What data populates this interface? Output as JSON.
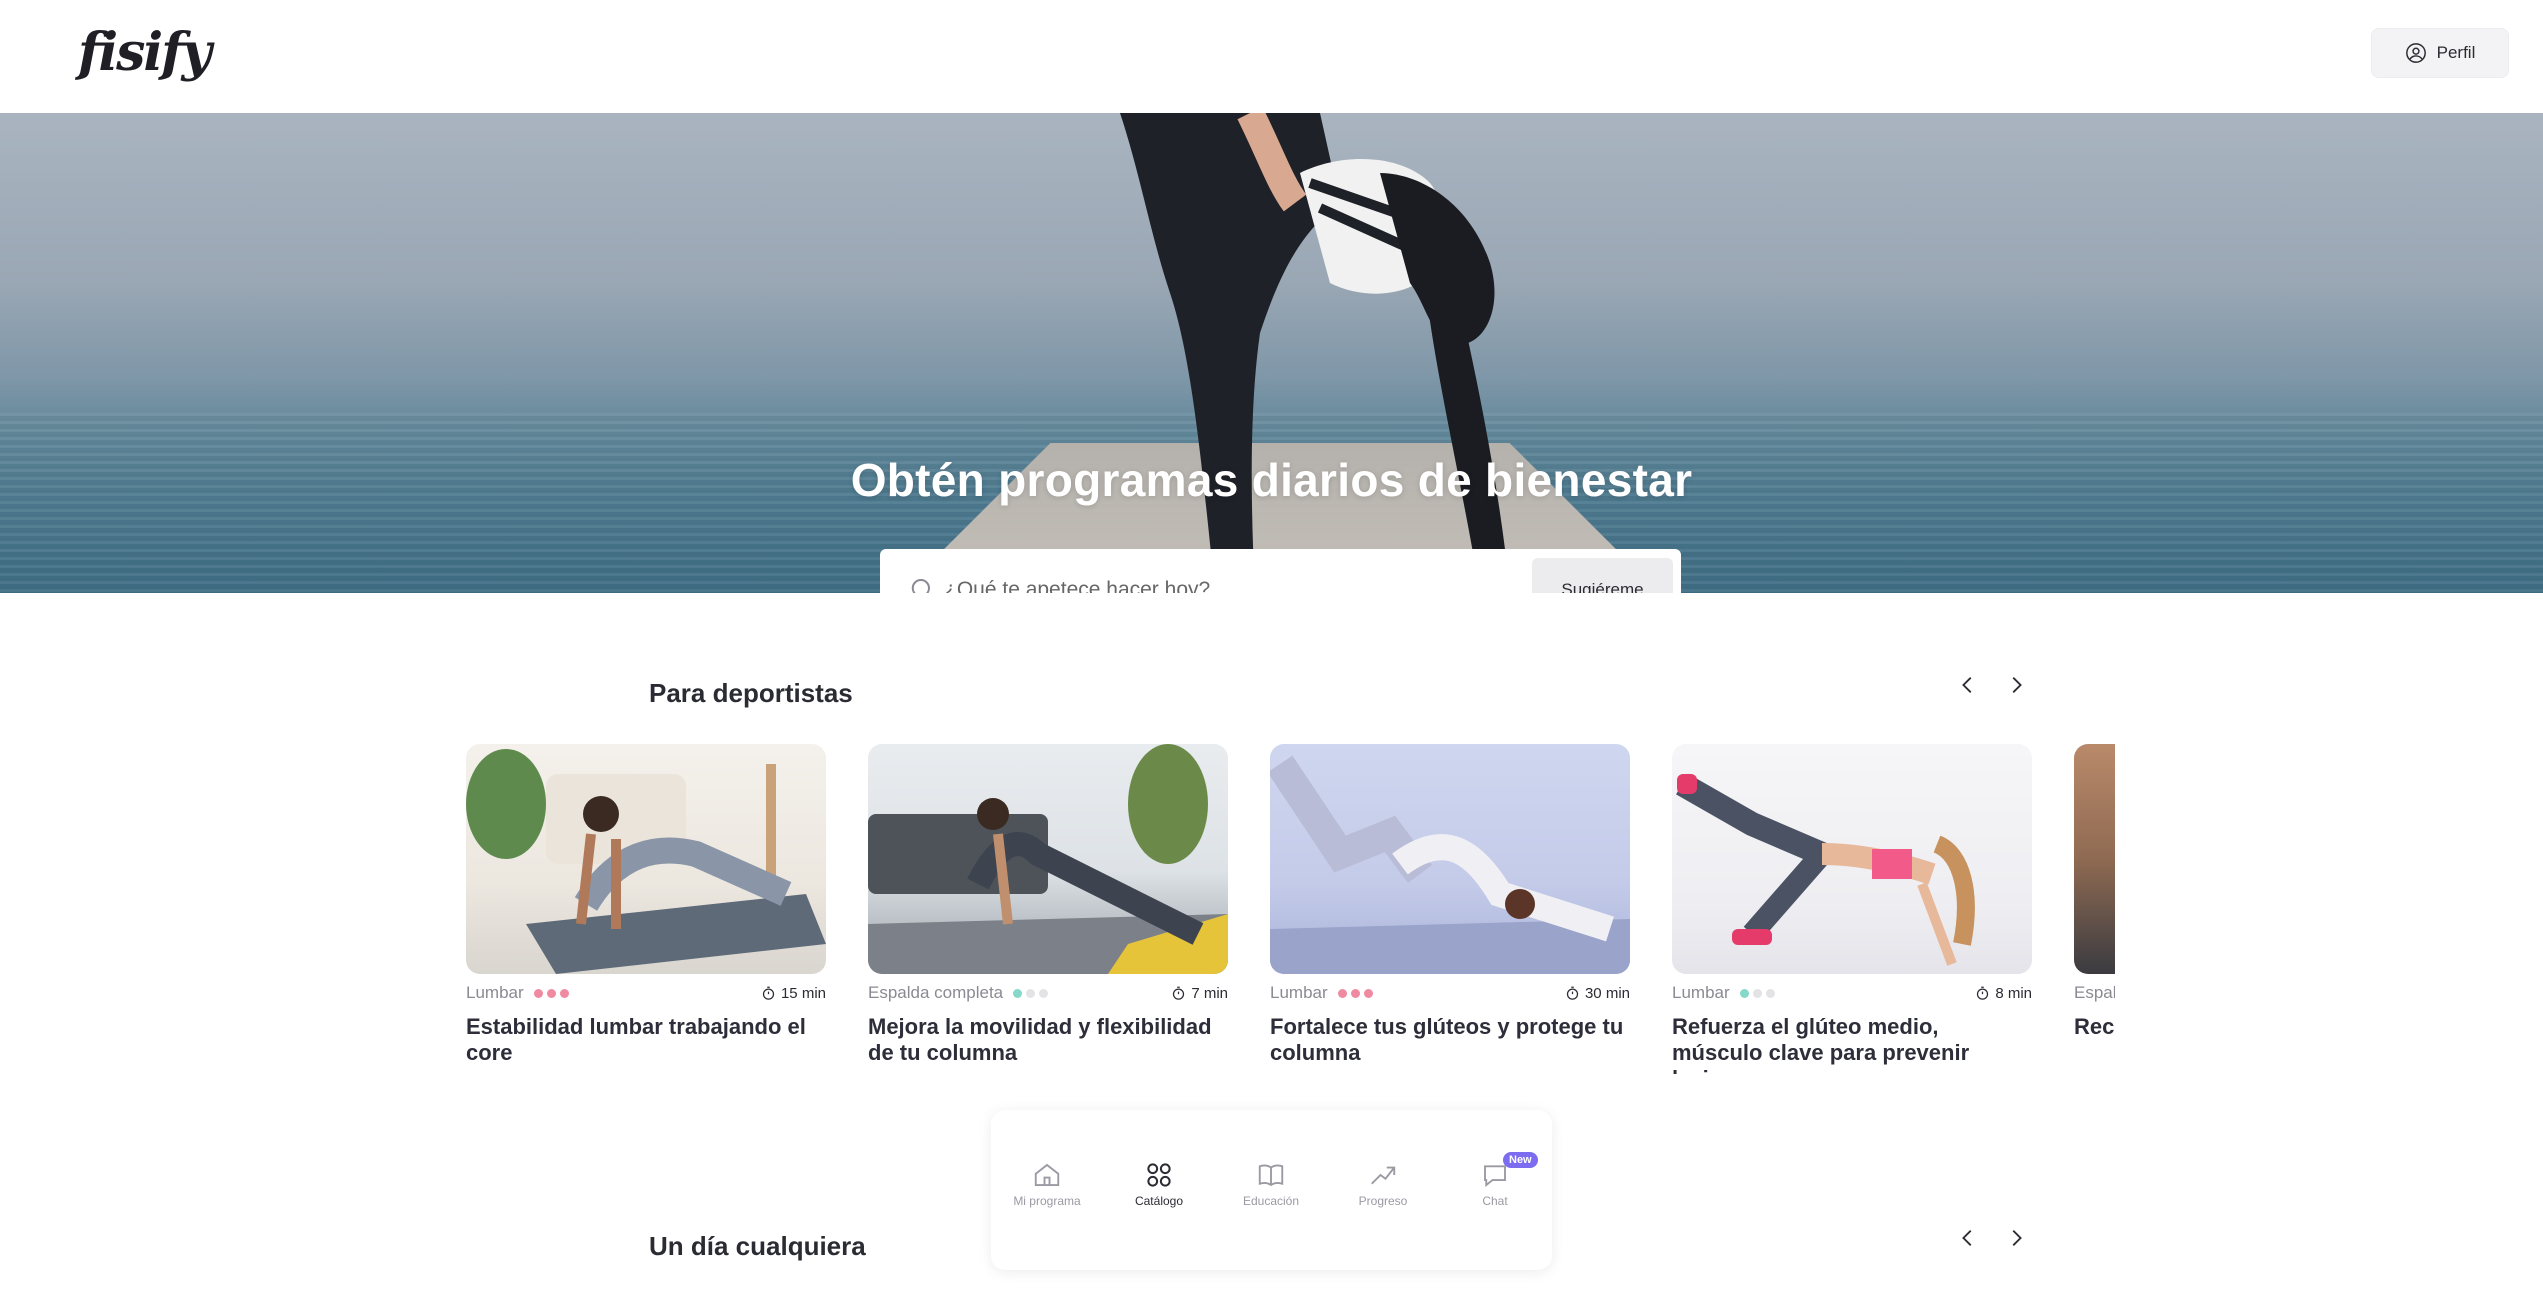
{
  "header": {
    "logo_text": "fisify",
    "profile_label": "Perfil"
  },
  "hero": {
    "title": "Obtén programas diarios de bienestar",
    "search_placeholder": "¿Qué te apetece hacer hoy?",
    "search_value": "",
    "suggest_label": "Sugiéreme"
  },
  "sections": [
    {
      "title": "Para deportistas",
      "cards": [
        {
          "category": "Lumbar",
          "duration": "15 min",
          "title": "Estabilidad lumbar trabajando el core",
          "level_filled": 3,
          "dot_color": "#f08aa0"
        },
        {
          "category": "Espalda completa",
          "duration": "7 min",
          "title": "Mejora la movilidad y flexibilidad de tu columna",
          "level_filled": 1,
          "dot_color": "#86d9c8"
        },
        {
          "category": "Lumbar",
          "duration": "30 min",
          "title": "Fortalece tus glúteos y protege tu columna",
          "level_filled": 3,
          "dot_color": "#f08aa0"
        },
        {
          "category": "Lumbar",
          "duration": "8 min",
          "title": "Refuerza el glúteo medio, músculo clave para prevenir lesiones",
          "level_filled": 1,
          "dot_color": "#86d9c8"
        },
        {
          "category": "Espal",
          "duration": "",
          "title": "Recu de u",
          "level_filled": 0,
          "dot_color": "#86d9c8"
        }
      ]
    },
    {
      "title": "Un día cualquiera",
      "cards": []
    }
  ],
  "bottom_nav": {
    "items": [
      {
        "label": "Mi programa",
        "icon": "home-icon",
        "active": false
      },
      {
        "label": "Catálogo",
        "icon": "grid-icon",
        "active": true
      },
      {
        "label": "Educación",
        "icon": "book-icon",
        "active": false
      },
      {
        "label": "Progreso",
        "icon": "trend-icon",
        "active": false
      },
      {
        "label": "Chat",
        "icon": "chat-icon",
        "active": false,
        "badge": "New"
      }
    ]
  },
  "colors": {
    "dot_inactive": "#e3e3e6",
    "badge": "#7c6cf0"
  }
}
